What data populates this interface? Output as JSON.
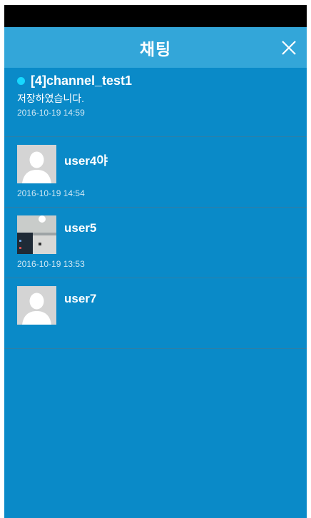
{
  "header": {
    "title": "채팅",
    "close_icon": "close-icon"
  },
  "channel": {
    "title": "[4]channel_test1",
    "message": "저장하였습니다.",
    "time": "2016-10-19 14:59",
    "dot_color": "#17d8ff"
  },
  "users": [
    {
      "name": "user4야",
      "time": "2016-10-19 14:54",
      "avatar": "default-avatar-icon"
    },
    {
      "name": "user5",
      "time": "2016-10-19 13:53",
      "avatar": "photo-avatar"
    },
    {
      "name": "user7",
      "time": "",
      "avatar": "default-avatar-icon"
    }
  ],
  "colors": {
    "background": "#0a8ac8",
    "header": "#33a6d9",
    "status_bar": "#000000"
  }
}
